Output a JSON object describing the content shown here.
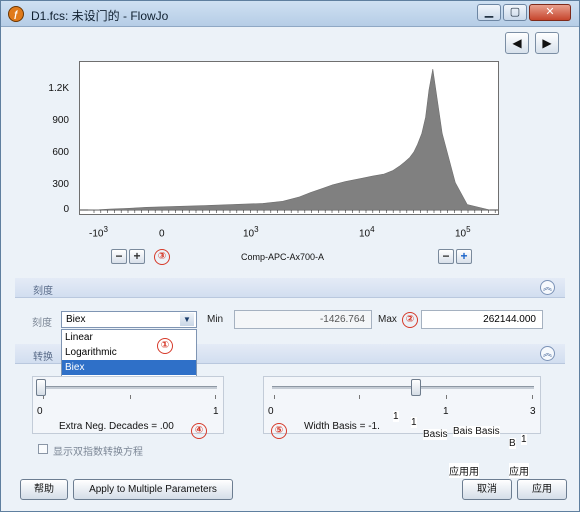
{
  "window": {
    "title": "D1.fcs: 未设门的 - FlowJo",
    "app_icon": "flowjo-icon"
  },
  "titlebar_buttons": {
    "minimize": "▁",
    "maximize": "▢",
    "close": "✕"
  },
  "nav": {
    "prev": "◀",
    "next": "▶"
  },
  "chart_data": {
    "type": "area",
    "x": [
      -1426.764,
      -1000,
      -700,
      -400,
      -200,
      0,
      200,
      400,
      700,
      1000,
      1500,
      2000,
      3000,
      5000,
      7000,
      10000,
      13000,
      16000,
      19000,
      22000,
      25000,
      28000,
      32000,
      36000,
      40000,
      45000,
      60000,
      90000,
      130000,
      262144
    ],
    "values": [
      0,
      3,
      8,
      15,
      25,
      40,
      60,
      80,
      120,
      160,
      200,
      230,
      260,
      290,
      310,
      330,
      360,
      400,
      440,
      480,
      530,
      600,
      700,
      850,
      1100,
      1290,
      700,
      250,
      50,
      0
    ],
    "xscale": "biex",
    "xlabel": "Comp-APC-Ax700-A",
    "ylabel": "",
    "ylim": [
      0,
      1300
    ],
    "y_ticks": [
      "1.2K",
      "900",
      "600",
      "300",
      "0"
    ],
    "fill": "#808080",
    "grid": false
  },
  "axis": {
    "x_tick_labels": [
      {
        "base": "-10",
        "exp": "3"
      },
      {
        "base": "0",
        "exp": ""
      },
      {
        "base": "10",
        "exp": "3"
      },
      {
        "base": "10",
        "exp": "4"
      },
      {
        "base": "10",
        "exp": "5"
      }
    ],
    "minus_label": "−",
    "plus_label": "+"
  },
  "markers": [
    "①",
    "②",
    "③",
    "④",
    "⑤"
  ],
  "scale": {
    "section_title": "刻度",
    "label": "刻度",
    "selected": "Biex",
    "options": [
      "Linear",
      "Logarithmic",
      "Biex"
    ],
    "min_label": "Min",
    "min_value": "-1426.764",
    "max_label": "Max",
    "max_value": "262144.000"
  },
  "transform": {
    "section_title": "转换",
    "extra_neg": {
      "min": "0",
      "max": "1",
      "label": "Extra Neg. Decades = .00",
      "value": 0
    },
    "width_basis": {
      "min": "0",
      "max": "3",
      "mid": "1",
      "label": "Width Basis = -1.",
      "value": 0.55
    },
    "checkbox_label": "显示双指数转换方程",
    "overlay_fragments": [
      "1",
      "1",
      "Basis",
      "Bais Basis",
      "B",
      "1",
      "应用用",
      "应用"
    ],
    "collapse_icon": "︽"
  },
  "footer": {
    "help": "帮助",
    "apply_multiple": "Apply to Multiple Parameters",
    "cancel": "取消",
    "apply": "应用"
  }
}
